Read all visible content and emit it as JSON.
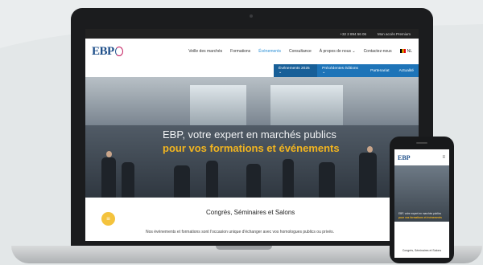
{
  "topbar": {
    "phone": "+32 2 894 56 06",
    "account": "Mon accès Premium"
  },
  "header": {
    "logo": "EBP",
    "nav": [
      {
        "label": "Veille des marchés"
      },
      {
        "label": "Formations"
      },
      {
        "label": "Événements",
        "active": true
      },
      {
        "label": "Consultance"
      },
      {
        "label": "À propos de nous ⌄"
      },
      {
        "label": "Contactez-nous"
      }
    ],
    "lang": "NL"
  },
  "subnav": [
    {
      "label": "Événements 2025 ⌄",
      "selected": true
    },
    {
      "label": "Précédentes éditions ⌄"
    },
    {
      "label": "Partenariat"
    },
    {
      "label": "Actualité"
    }
  ],
  "hero": {
    "title": "EBP, votre expert en marchés publics",
    "subtitle": "pour vos formations et événements"
  },
  "section": {
    "title": "Congrès, Séminaires et Salons",
    "text": "Nos événements et formations sont l'occasion unique d'échanger avec vos homologues publics ou privés."
  },
  "phone": {
    "logo": "EBP",
    "section_title": "Congrès, Séminaires et Salons"
  },
  "colors": {
    "accent": "#2a8fd6",
    "subnav": "#1e74b8",
    "highlight": "#f2b51f"
  }
}
